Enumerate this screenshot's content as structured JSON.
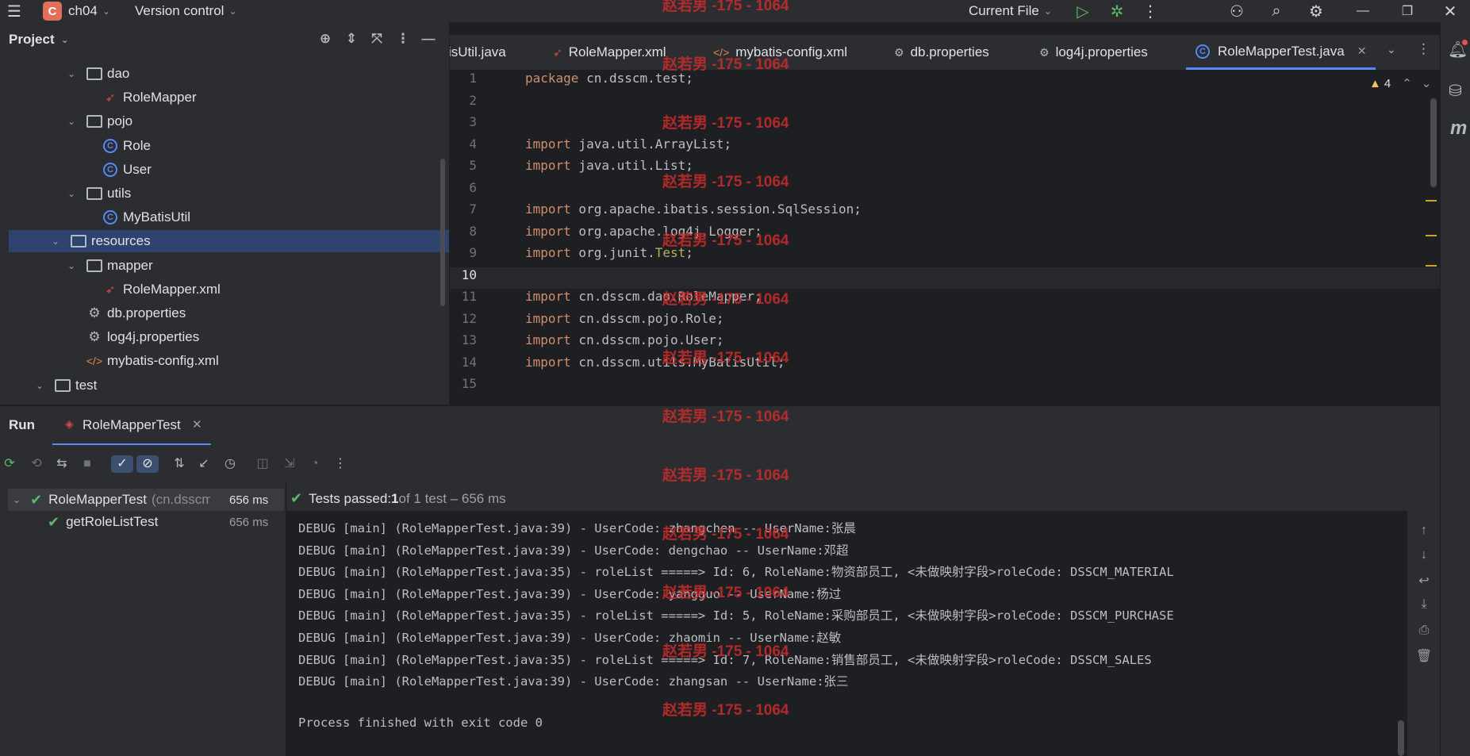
{
  "titlebar": {
    "project_badge": "C",
    "project_name": "ch04",
    "vcs": "Version control",
    "run_config": "Current File",
    "icons": [
      "hamburger-menu-icon",
      "run-icon",
      "debug-icon",
      "more-icon",
      "add-user-icon",
      "search-icon",
      "settings-icon",
      "minimize-icon",
      "restore-icon",
      "close-icon"
    ]
  },
  "project_panel": {
    "title": "Project",
    "tree": [
      {
        "label": "dao",
        "type": "package",
        "indent": 1,
        "expanded": true
      },
      {
        "label": "RoleMapper",
        "type": "mapper-interface",
        "indent": 2
      },
      {
        "label": "pojo",
        "type": "package",
        "indent": 1,
        "expanded": true
      },
      {
        "label": "Role",
        "type": "class",
        "indent": 2
      },
      {
        "label": "User",
        "type": "class",
        "indent": 2
      },
      {
        "label": "utils",
        "type": "package",
        "indent": 1,
        "expanded": true
      },
      {
        "label": "MyBatisUtil",
        "type": "class",
        "indent": 2
      },
      {
        "label": "resources",
        "type": "resource-folder",
        "indent": 0,
        "expanded": true,
        "selected": true
      },
      {
        "label": "mapper",
        "type": "folder",
        "indent": 1,
        "expanded": true
      },
      {
        "label": "RoleMapper.xml",
        "type": "mapper-xml",
        "indent": 2
      },
      {
        "label": "db.properties",
        "type": "properties",
        "indent": 1
      },
      {
        "label": "log4j.properties",
        "type": "properties",
        "indent": 1
      },
      {
        "label": "mybatis-config.xml",
        "type": "xml",
        "indent": 1
      },
      {
        "label": "test",
        "type": "folder",
        "indent": -1,
        "expanded": true
      }
    ]
  },
  "editor": {
    "tabs": [
      {
        "label": "isUtil.java",
        "icon": "none"
      },
      {
        "label": "RoleMapper.xml",
        "icon": "mapper-xml"
      },
      {
        "label": "mybatis-config.xml",
        "icon": "xml"
      },
      {
        "label": "db.properties",
        "icon": "properties"
      },
      {
        "label": "log4j.properties",
        "icon": "properties"
      },
      {
        "label": "RoleMapperTest.java",
        "icon": "class",
        "active": true
      }
    ],
    "warning_count": "4",
    "lines": [
      {
        "n": "1",
        "kw": "package",
        "rest": " cn.dsscm.test;"
      },
      {
        "n": "2",
        "kw": "",
        "rest": ""
      },
      {
        "n": "3",
        "kw": "",
        "rest": ""
      },
      {
        "n": "4",
        "kw": "import",
        "rest": " java.util.ArrayList;"
      },
      {
        "n": "5",
        "kw": "import",
        "rest": " java.util.List;"
      },
      {
        "n": "6",
        "kw": "",
        "rest": ""
      },
      {
        "n": "7",
        "kw": "import",
        "rest": " org.apache.ibatis.session.SqlSession;"
      },
      {
        "n": "8",
        "kw": "import",
        "rest": " org.apache.log4j.Logger;"
      },
      {
        "n": "9",
        "kw": "import",
        "rest": " org.junit.",
        "ann": "Test",
        ";": ";"
      },
      {
        "n": "10",
        "kw": "",
        "rest": ""
      },
      {
        "n": "11",
        "kw": "import",
        "rest": " cn.dsscm.dao.RoleMapper;"
      },
      {
        "n": "12",
        "kw": "import",
        "rest": " cn.dsscm.pojo.Role;"
      },
      {
        "n": "13",
        "kw": "import",
        "rest": " cn.dsscm.pojo.User;"
      },
      {
        "n": "14",
        "kw": "import",
        "rest": " cn.dsscm.utils.MyBatisUtil;"
      },
      {
        "n": "15",
        "kw": "",
        "rest": ""
      }
    ]
  },
  "run_panel": {
    "title": "Run",
    "tab_label": "RoleMapperTest",
    "summary_prefix": "Tests passed: ",
    "summary_count": "1",
    "summary_rest": " of 1 test – 656 ms",
    "tests": [
      {
        "label": "RoleMapperTest",
        "package": "(cn.dsscm.te",
        "duration": "656 ms"
      },
      {
        "label": "getRoleListTest",
        "duration": "656 ms"
      }
    ],
    "console": [
      "DEBUG [main] (RoleMapperTest.java:39) - UserCode: zhangchen -- UserName:张晨",
      "DEBUG [main] (RoleMapperTest.java:39) - UserCode: dengchao -- UserName:邓超",
      "DEBUG [main] (RoleMapperTest.java:35) - roleList =====> Id: 6, RoleName:物资部员工, <未做映射字段>roleCode: DSSCM_MATERIAL",
      "DEBUG [main] (RoleMapperTest.java:39) - UserCode: yangguo -- UserName:杨过",
      "DEBUG [main] (RoleMapperTest.java:35) - roleList =====> Id: 5, RoleName:采购部员工, <未做映射字段>roleCode: DSSCM_PURCHASE",
      "DEBUG [main] (RoleMapperTest.java:39) - UserCode: zhaomin -- UserName:赵敏",
      "DEBUG [main] (RoleMapperTest.java:35) - roleList =====> Id: 7, RoleName:销售部员工, <未做映射字段>roleCode: DSSCM_SALES",
      "DEBUG [main] (RoleMapperTest.java:39) - UserCode: zhangsan -- UserName:张三",
      "",
      "Process finished with exit code 0"
    ]
  },
  "watermark": "赵若男 -175 - 1064",
  "colors": {
    "accent": "#548af7",
    "selection": "#2e436e",
    "success": "#5fb865",
    "watermark": "#cc2b2b",
    "keyword": "#cf8e6d"
  }
}
